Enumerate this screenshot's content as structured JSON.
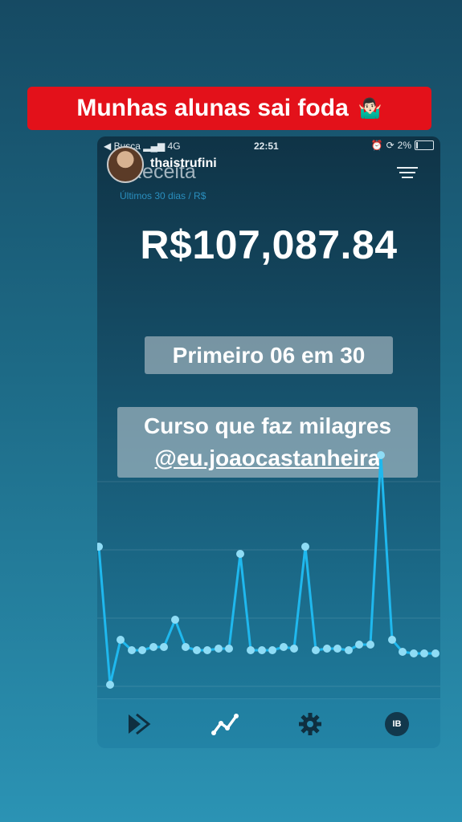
{
  "story": {
    "banner_text": "Munhas alunas sai foda",
    "banner_emoji": "🤷🏻‍♂️"
  },
  "statusbar": {
    "left": "◀ Busca ▂▄▆ 4G",
    "time": "22:51",
    "battery": "2%"
  },
  "profile": {
    "username": "thaistrufini"
  },
  "app": {
    "title": "Receita",
    "subtitle": "Últimos 30 dias / R$",
    "amount": "R$107,087.84"
  },
  "stickers": {
    "line1": "Primeiro 06 em 30",
    "line2": "Curso que faz milagres",
    "handle": "@eu.joaocastanheira"
  },
  "chart_data": {
    "type": "line",
    "title": "",
    "xlabel": "",
    "ylabel": "",
    "x": [
      1,
      2,
      3,
      4,
      5,
      6,
      7,
      8,
      9,
      10,
      11,
      12,
      13,
      14,
      15,
      16,
      17,
      18,
      19,
      20,
      21,
      22,
      23,
      24,
      25,
      26,
      27,
      28,
      29,
      30,
      31,
      32
    ],
    "values": [
      10000,
      400,
      3500,
      2800,
      2800,
      3000,
      3000,
      4900,
      3000,
      2800,
      2800,
      2900,
      2900,
      9500,
      2800,
      2800,
      2800,
      3000,
      2900,
      10000,
      2800,
      2900,
      2900,
      2800,
      3200,
      3200,
      16400,
      3500,
      2700,
      2600,
      2600,
      2600
    ],
    "ylim": [
      0,
      17000
    ],
    "color": "#1fb8ee",
    "grid": true
  },
  "tabbar": {
    "items": [
      "forward-icon",
      "chart-icon",
      "gear-icon",
      "profile-badge"
    ],
    "profile_initials": "IB"
  }
}
